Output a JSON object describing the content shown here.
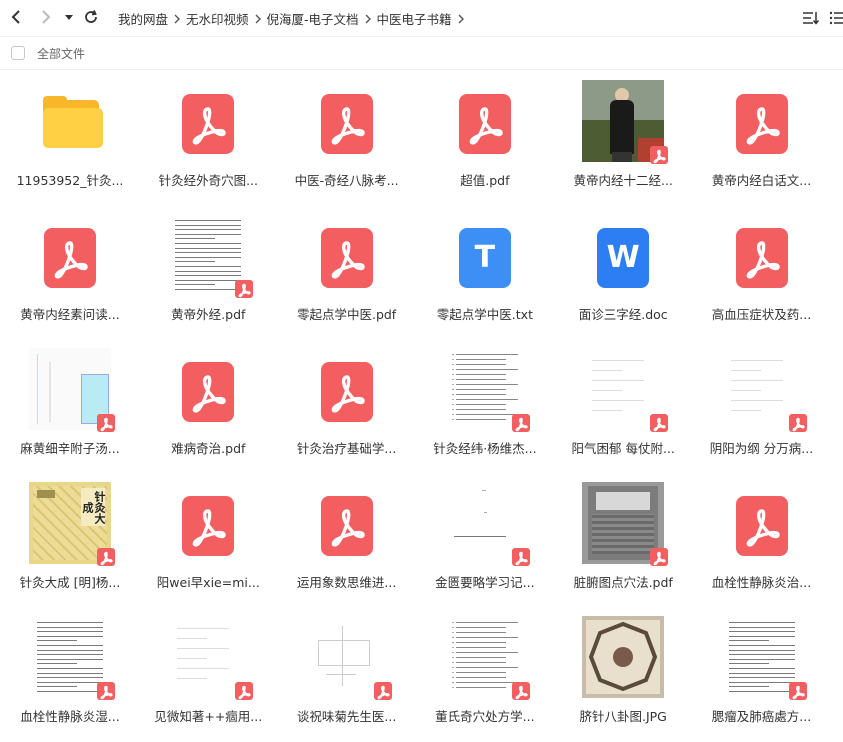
{
  "breadcrumb": [
    "我的网盘",
    "无水印视频",
    "倪海厦-电子文档",
    "中医电子书籍"
  ],
  "selection": {
    "label": "全部文件"
  },
  "icons": {
    "back": "chevron-left-icon",
    "forward": "chevron-right-icon",
    "history": "caret-down-icon",
    "refresh": "refresh-icon",
    "sort": "sort-icon",
    "view": "list-view-icon"
  },
  "colors": {
    "pdf": "#f35f61",
    "txt": "#3d8ff5",
    "doc": "#2d7ef2",
    "folder": "#ffcf44"
  },
  "files": [
    {
      "name": "11953952_针灸...",
      "type": "folder"
    },
    {
      "name": "针灸经外奇穴图...",
      "type": "pdf"
    },
    {
      "name": "中医-奇经八脉考...",
      "type": "pdf"
    },
    {
      "name": "超值.pdf",
      "type": "pdf"
    },
    {
      "name": "黄帝内经十二经...",
      "type": "photo"
    },
    {
      "name": "黄帝内经白话文...",
      "type": "pdf"
    },
    {
      "name": "黄帝内经素问读...",
      "type": "pdf"
    },
    {
      "name": "黄帝外经.pdf",
      "type": "textpage"
    },
    {
      "name": "零起点学中医.pdf",
      "type": "pdf"
    },
    {
      "name": "零起点学中医.txt",
      "type": "txt",
      "glyph": "T"
    },
    {
      "name": "面诊三字经.doc",
      "type": "doc",
      "glyph": "W"
    },
    {
      "name": "高血压症状及药...",
      "type": "pdf"
    },
    {
      "name": "麻黄细辛附子汤...",
      "type": "chartpage"
    },
    {
      "name": "难病奇治.pdf",
      "type": "pdf"
    },
    {
      "name": "针灸治疗基础学...",
      "type": "pdf"
    },
    {
      "name": "针灸经纬·杨维杰...",
      "type": "tablepage"
    },
    {
      "name": "阳气困郁 每仗附...",
      "type": "blankpage"
    },
    {
      "name": "阴阳为纲 分万病...",
      "type": "blankpage"
    },
    {
      "name": "针灸大成 [明]杨...",
      "type": "bookcover",
      "cover_text": "针灸大成"
    },
    {
      "name": "阳wei早xie=mi...",
      "type": "pdf"
    },
    {
      "name": "运用象数思维进...",
      "type": "pdf"
    },
    {
      "name": "金匮要略学习记...",
      "type": "sparsepage"
    },
    {
      "name": "脏腑图点穴法.pdf",
      "type": "stonepage"
    },
    {
      "name": "血栓性静脉炎治...",
      "type": "pdf"
    },
    {
      "name": "血栓性静脉炎湿...",
      "type": "textpage"
    },
    {
      "name": "见微知著++痼用...",
      "type": "blankpage"
    },
    {
      "name": "谈祝味菊先生医...",
      "type": "diagrampage"
    },
    {
      "name": "董氏奇穴处方学...",
      "type": "tablepage"
    },
    {
      "name": "脐针八卦图.JPG",
      "type": "bagua"
    },
    {
      "name": "腮瘤及肺癌處方...",
      "type": "textpage"
    }
  ]
}
